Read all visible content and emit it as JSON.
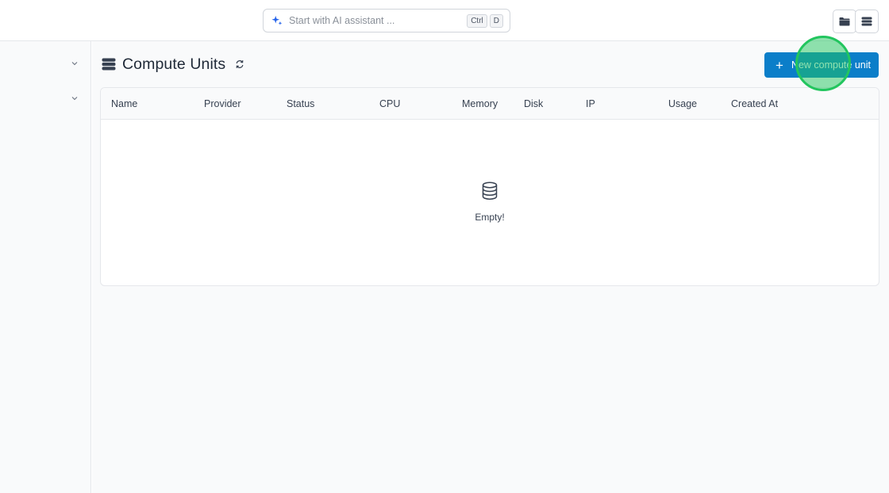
{
  "topbar": {
    "ai_search": {
      "placeholder": "Start with AI assistant ...",
      "shortcut_ctrl": "Ctrl",
      "shortcut_key": "D"
    },
    "icons": [
      "folder-icon",
      "server-icon"
    ]
  },
  "page": {
    "title": "Compute Units",
    "new_button_label": "New compute unit"
  },
  "table": {
    "columns": [
      "Name",
      "Provider",
      "Status",
      "CPU",
      "Memory",
      "Disk",
      "IP",
      "Usage",
      "Created At"
    ],
    "rows": [],
    "empty_text": "Empty!"
  },
  "colors": {
    "accent": "#0b7ec9",
    "click_marker": "#22c55e"
  }
}
